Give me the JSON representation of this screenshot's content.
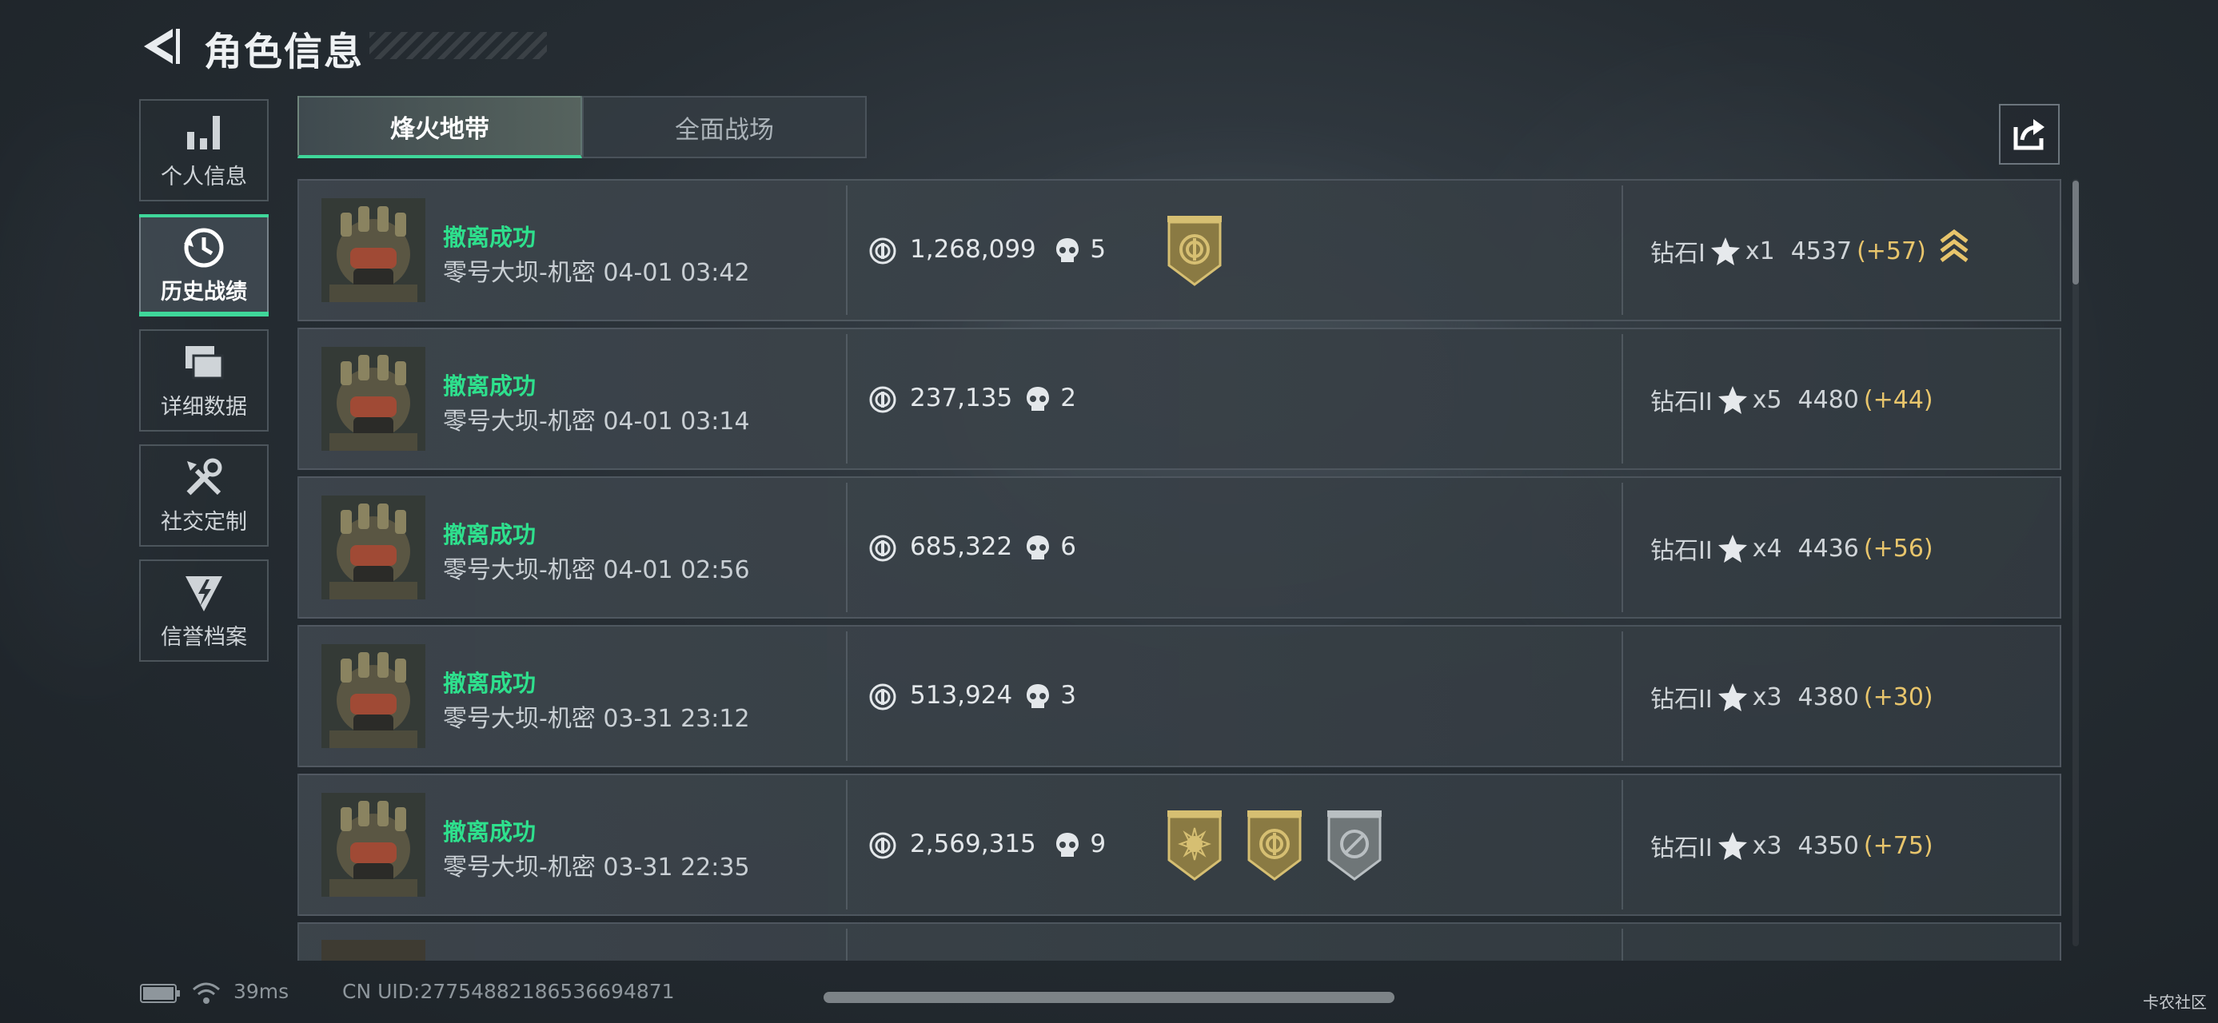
{
  "header": {
    "title": "角色信息"
  },
  "sidebar": {
    "items": [
      {
        "label": "个人信息",
        "icon": "bar-chart-icon",
        "active": false
      },
      {
        "label": "历史战绩",
        "icon": "history-clock-icon",
        "active": true
      },
      {
        "label": "详细数据",
        "icon": "folder-stack-icon",
        "active": false
      },
      {
        "label": "社交定制",
        "icon": "tools-icon",
        "active": false
      },
      {
        "label": "信誉档案",
        "icon": "credit-shield-icon",
        "active": false
      }
    ]
  },
  "tabs": [
    {
      "label": "烽火地带",
      "active": true
    },
    {
      "label": "全面战场",
      "active": false
    }
  ],
  "share": {
    "icon": "share-icon"
  },
  "records": [
    {
      "status": "撤离成功",
      "map": "零号大坝-机密",
      "time": "04-01 03:42",
      "value": "1,268,099",
      "kills": "5",
      "badges": [
        "gold-emblem-badge"
      ],
      "rank": "钻石I",
      "stars": "x1",
      "score": "4537",
      "delta": "(+57)",
      "rank_up": true
    },
    {
      "status": "撤离成功",
      "map": "零号大坝-机密",
      "time": "04-01 03:14",
      "value": "237,135",
      "kills": "2",
      "badges": [],
      "rank": "钻石II",
      "stars": "x5",
      "score": "4480",
      "delta": "(+44)",
      "rank_up": false
    },
    {
      "status": "撤离成功",
      "map": "零号大坝-机密",
      "time": "04-01 02:56",
      "value": "685,322",
      "kills": "6",
      "badges": [],
      "rank": "钻石II",
      "stars": "x4",
      "score": "4436",
      "delta": "(+56)",
      "rank_up": false
    },
    {
      "status": "撤离成功",
      "map": "零号大坝-机密",
      "time": "03-31 23:12",
      "value": "513,924",
      "kills": "3",
      "badges": [],
      "rank": "钻石II",
      "stars": "x3",
      "score": "4380",
      "delta": "(+30)",
      "rank_up": false
    },
    {
      "status": "撤离成功",
      "map": "零号大坝-机密",
      "time": "03-31 22:35",
      "value": "2,569,315",
      "kills": "9",
      "badges": [
        "gold-sun-badge",
        "gold-emblem-badge",
        "silver-target-badge"
      ],
      "rank": "钻石II",
      "stars": "x3",
      "score": "4350",
      "delta": "(+75)",
      "rank_up": false
    }
  ],
  "footer": {
    "ping": "39ms",
    "uid": "CN UID:27754882186536694871",
    "watermark": "卡农社区"
  },
  "colors": {
    "accent": "#3fd79a",
    "success": "#2ee08d",
    "delta": "#e8c56c"
  }
}
